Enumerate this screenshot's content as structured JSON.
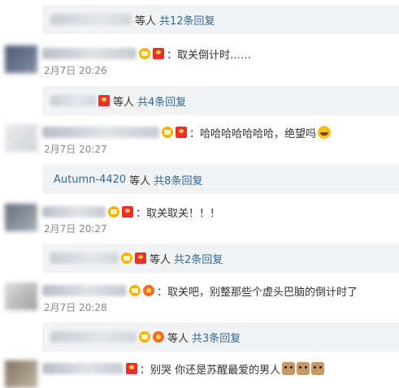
{
  "reply_bars": [
    {
      "suffix": "等人",
      "count": "共12条回复"
    },
    {
      "suffix": "等人",
      "count": "共4条回复"
    },
    {
      "named": "Autumn-4420",
      "suffix": "等人",
      "count": "共8条回复"
    },
    {
      "suffix": "等人",
      "count": "共2条回复"
    },
    {
      "suffix": "等人",
      "count": "共3条回复"
    }
  ],
  "comments": [
    {
      "text": "：取关倒计时……",
      "time": "2月7日 20:26"
    },
    {
      "text": "：哈哈哈哈哈哈哈，绝望吗",
      "time": "2月7日 20:27"
    },
    {
      "text": "：取关取关！！！",
      "time": "2月7日 20:27"
    },
    {
      "text": "：取关吧，别整那些个虚头巴脑的倒计时了",
      "time": "2月7日 20:28"
    },
    {
      "text": "：别哭 你还是苏醒最爱的男人",
      "time": ""
    }
  ],
  "colors": {
    "link": "#2f6a9b",
    "bar_bg": "#f2f3f5",
    "time": "#888888"
  },
  "icons": [
    "crown-badge-icon",
    "red-packet-badge-icon",
    "flower-badge-icon",
    "laugh-emoji-icon",
    "face-emoji-icon"
  ]
}
